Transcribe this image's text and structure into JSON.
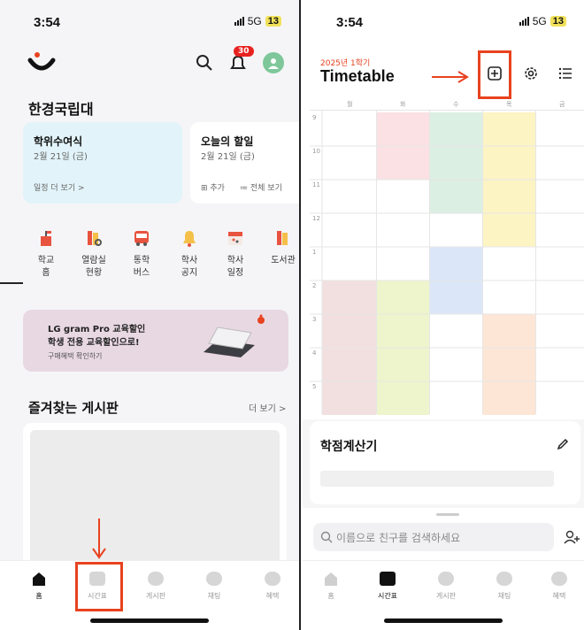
{
  "left": {
    "status": {
      "time": "3:54",
      "network": "5G",
      "battery": "13"
    },
    "header": {
      "notification_count": "30"
    },
    "school_name": "한경국립대",
    "card_degree": {
      "title": "학위수여식",
      "date": "2월 21일 (금)",
      "link": "일정 더 보기 >"
    },
    "card_todo": {
      "title": "오늘의 할일",
      "date": "2월 21일 (금)",
      "add": "추가",
      "view_all": "전체 보기"
    },
    "services": [
      {
        "line1": "학교",
        "line2": "홈",
        "icon": "school-home-icon"
      },
      {
        "line1": "열람실",
        "line2": "현황",
        "icon": "reading-room-icon"
      },
      {
        "line1": "통학",
        "line2": "버스",
        "icon": "bus-icon"
      },
      {
        "line1": "학사",
        "line2": "공지",
        "icon": "notice-bell-icon"
      },
      {
        "line1": "학사",
        "line2": "일정",
        "icon": "calendar-icon"
      },
      {
        "line1": "도서관",
        "line2": "",
        "icon": "library-icon"
      }
    ],
    "banner": {
      "line1": "LG gram Pro 교육할인",
      "line2": "학생 전용 교육할인으로!",
      "sub": "구매혜택 확인하기"
    },
    "favorites": {
      "title": "즐겨찾는 게시판",
      "more": "더 보기 >"
    },
    "tabs": [
      "홈",
      "시간표",
      "게시판",
      "채팅",
      "혜택"
    ]
  },
  "right": {
    "status": {
      "time": "3:54",
      "network": "5G",
      "battery": "13"
    },
    "semester": "2025년 1학기",
    "title": "Timetable",
    "days": [
      "월",
      "화",
      "수",
      "목",
      "금"
    ],
    "hours": [
      "9",
      "10",
      "11",
      "12",
      "1",
      "2",
      "3",
      "4",
      "5"
    ],
    "grade_calc": {
      "title": "학점계산기"
    },
    "search": {
      "placeholder": "이름으로 친구를 검색하세요"
    },
    "tabs": [
      "홈",
      "시간표",
      "게시판",
      "채팅",
      "혜택"
    ],
    "colors": {
      "pink": "#fbe1e4",
      "mint": "#dcefe3",
      "yellow": "#fdf4c4",
      "blue": "#dbe6f8",
      "rose": "#f2e0e0",
      "lime": "#eef5cc",
      "peach": "#fde6d6"
    }
  },
  "accent": "#e8421f"
}
